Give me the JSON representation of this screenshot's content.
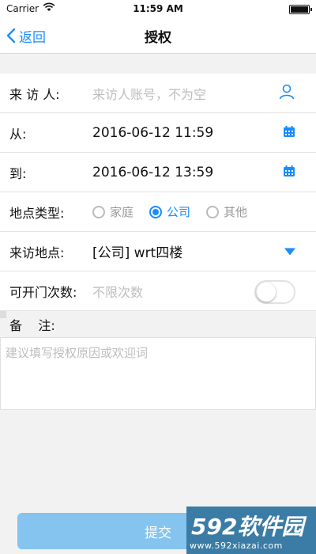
{
  "status_bar": {
    "carrier": "Carrier",
    "time": "11:59 AM"
  },
  "nav": {
    "back_label": "返回",
    "title": "授权"
  },
  "form": {
    "visitor": {
      "label": "来 访 人:",
      "placeholder": "来访人账号，不为空",
      "icon": "person-icon"
    },
    "from": {
      "label": "从:",
      "value": "2016-06-12 11:59",
      "icon": "calendar-icon"
    },
    "to": {
      "label": "到:",
      "value": "2016-06-12 13:59",
      "icon": "calendar-icon"
    },
    "location_type": {
      "label": "地点类型:",
      "options": [
        "家庭",
        "公司",
        "其他"
      ],
      "selected": "公司"
    },
    "location": {
      "label": "来访地点:",
      "value": "[公司] wrt四楼",
      "icon": "dropdown-triangle-icon"
    },
    "door_count": {
      "label": "可开门次数:",
      "placeholder": "不限次数",
      "toggle_on": false
    },
    "remark": {
      "label": "备    注:",
      "placeholder": "建议填写授权原因或欢迎词"
    }
  },
  "submit_label": "提交",
  "watermark": {
    "brand": "592软件园",
    "url": "www.592xiazai.com"
  },
  "colors": {
    "accent": "#1a8cff",
    "submit_bg": "#85c4ee",
    "background": "#f2f2f2"
  }
}
